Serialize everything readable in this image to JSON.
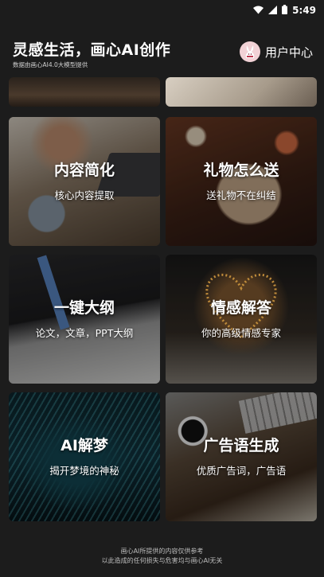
{
  "status_bar": {
    "time": "5:49"
  },
  "header": {
    "title": "灵感生活，画心AI创作",
    "subtitle": "数据由画心AI4.0大模型提供",
    "user_center_label": "用户中心"
  },
  "cards": [
    {
      "title": "内容简化",
      "subtitle": "核心内容提取"
    },
    {
      "title": "礼物怎么送",
      "subtitle": "送礼物不在纠结"
    },
    {
      "title": "一键大纲",
      "subtitle": "论文，文章，PPT大纲"
    },
    {
      "title": "情感解答",
      "subtitle": "你的高级情感专家"
    },
    {
      "title": "AI解梦",
      "subtitle": "揭开梦境的神秘"
    },
    {
      "title": "广告语生成",
      "subtitle": "优质广告词，广告语"
    }
  ],
  "footer": {
    "line1": "画心AI所提供的内容仅供参考",
    "line2": "以此造成的任何损失与危害均与画心AI无关"
  },
  "colors": {
    "background": "#1c1c1c",
    "avatar_bg": "#f2d2d6"
  }
}
